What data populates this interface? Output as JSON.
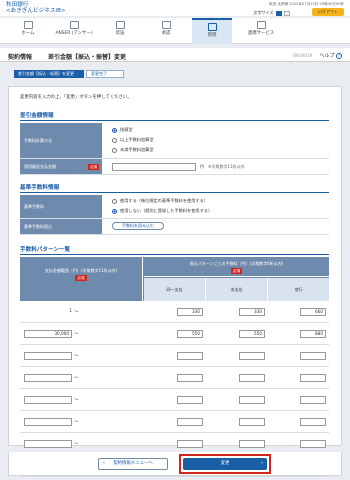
{
  "header": {
    "bank_line1": "秋田銀行",
    "bank_line2": "<あきぎんビジネスIB>",
    "user_info": "秋田 太郎様 2022年07月13日 09時30分00秒",
    "font_size_label": "文字サイズ",
    "logout_label": "ログアウト"
  },
  "nav": {
    "items": [
      {
        "label": "ホーム",
        "icon": "home-icon"
      },
      {
        "label": "ANSER (アンサー)",
        "icon": "phone-icon"
      },
      {
        "label": "伝送",
        "icon": "transfer-icon"
      },
      {
        "label": "承認",
        "icon": "approval-icon"
      },
      {
        "label": "管理",
        "icon": "management-icon"
      },
      {
        "label": "連携サービス",
        "icon": "service-icon"
      }
    ]
  },
  "page": {
    "category": "契約情報",
    "title": "差引金額【振込・振替】変更",
    "code": "BKGK019",
    "help_label": "ヘルプ"
  },
  "steps": {
    "current": "差引金額【振込・振替】を変更",
    "next": "変更完了"
  },
  "intro": "変更内容を入力の上、「変更」ボタンを押してください。",
  "section_deduction": {
    "title": "差引金額情報",
    "method_label": "手数料計算方法",
    "options": [
      "指値型",
      "以上手数料加算型",
      "未満手数料加算型"
    ],
    "selected_option": "指値型",
    "unit_amount_label": "適用最低支払金額",
    "required": "必須",
    "unit_amount_value": "",
    "yen": "円",
    "unit_note": "※半角数字11桁以内"
  },
  "section_base_fee": {
    "title": "基準手数料情報",
    "base_fee_label": "基準手数料",
    "options": [
      "使用する（帳位規定の基準手数料を使用する）",
      "使用しない（個別に登録した手数料を使用する）"
    ],
    "selected_option": "使用しない（個別に登録した手数料を使用する）",
    "read_label": "基準手数料読込",
    "read_button": "手数料を読み込む"
  },
  "fee_pattern": {
    "title": "手数料パターン一覧",
    "col_amount": "支払金額範囲（円）(半角数字11桁以内)",
    "col_fee": "振込パターンごとの手数料（円）(半角数字6桁以内)",
    "required": "必須",
    "sub_cols": [
      "同一支店",
      "本支店",
      "他行"
    ],
    "tilde": "〜",
    "rows": [
      {
        "from": "1",
        "from_editable": false,
        "fees": [
          "330",
          "330",
          "660"
        ]
      },
      {
        "from": "30,000",
        "from_editable": true,
        "fees": [
          "550",
          "550",
          "880"
        ]
      },
      {
        "from": "",
        "from_editable": true,
        "fees": [
          "",
          "",
          ""
        ]
      },
      {
        "from": "",
        "from_editable": true,
        "fees": [
          "",
          "",
          ""
        ]
      },
      {
        "from": "",
        "from_editable": true,
        "fees": [
          "",
          "",
          ""
        ]
      },
      {
        "from": "",
        "from_editable": true,
        "fees": [
          "",
          "",
          ""
        ]
      },
      {
        "from": "",
        "from_editable": true,
        "fees": [
          "",
          "",
          ""
        ]
      },
      {
        "from": "",
        "from_editable": true,
        "fees": [
          "",
          "",
          ""
        ]
      }
    ]
  },
  "footer": {
    "back_label": "契約情報メニューへ",
    "change_label": "変更"
  }
}
